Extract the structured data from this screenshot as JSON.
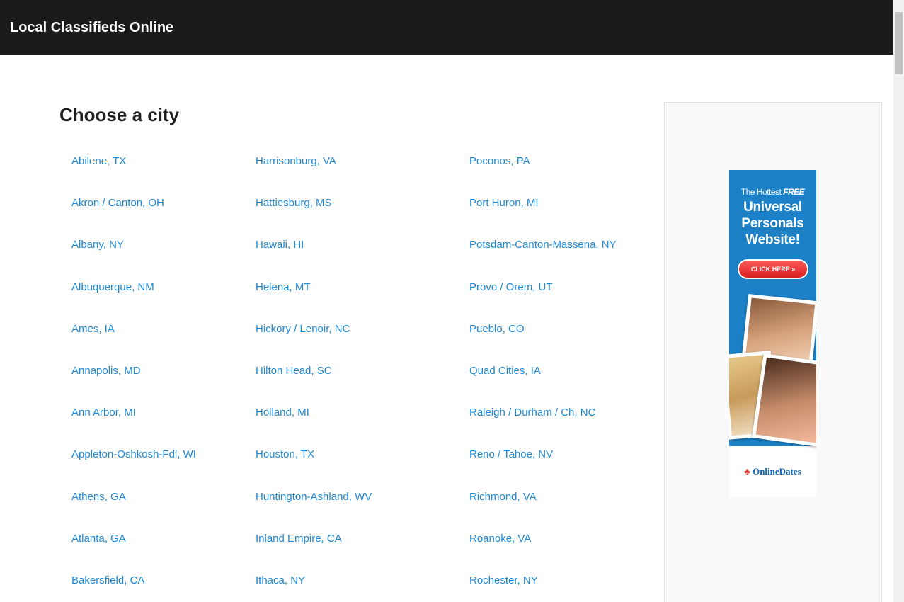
{
  "header": {
    "title": "Local Classifieds Online"
  },
  "main": {
    "title": "Choose a city",
    "columns": [
      [
        "Abilene, TX",
        "Akron / Canton, OH",
        "Albany, NY",
        "Albuquerque, NM",
        "Ames, IA",
        "Annapolis, MD",
        "Ann Arbor, MI",
        "Appleton-Oshkosh-Fdl, WI",
        "Athens, GA",
        "Atlanta, GA",
        "Bakersfield, CA"
      ],
      [
        "Harrisonburg, VA",
        "Hattiesburg, MS",
        "Hawaii, HI",
        "Helena, MT",
        "Hickory / Lenoir, NC",
        "Hilton Head, SC",
        "Holland, MI",
        "Houston, TX",
        "Huntington-Ashland, WV",
        "Inland Empire, CA",
        "Ithaca, NY"
      ],
      [
        "Poconos, PA",
        "Port Huron, MI",
        "Potsdam-Canton-Massena, NY",
        "Provo / Orem, UT",
        "Pueblo, CO",
        "Quad Cities, IA",
        "Raleigh / Durham / Ch, NC",
        "Reno / Tahoe, NV",
        "Richmond, VA",
        "Roanoke, VA",
        "Rochester, NY"
      ]
    ]
  },
  "ad": {
    "tagline_prefix": "The Hottest",
    "tagline_emphasis": "FREE",
    "headline": [
      "Universal",
      "Personals",
      "Website!"
    ],
    "cta": "CLICK HERE »",
    "brand": "OnlineDates"
  },
  "colors": {
    "header_bg": "#1b1b1b",
    "link": "#1e88d4",
    "ad_blue": "#1b80c6",
    "cta_red": "#e02828"
  },
  "icons": {
    "brand_logo": "onlinedates-logo-icon"
  }
}
